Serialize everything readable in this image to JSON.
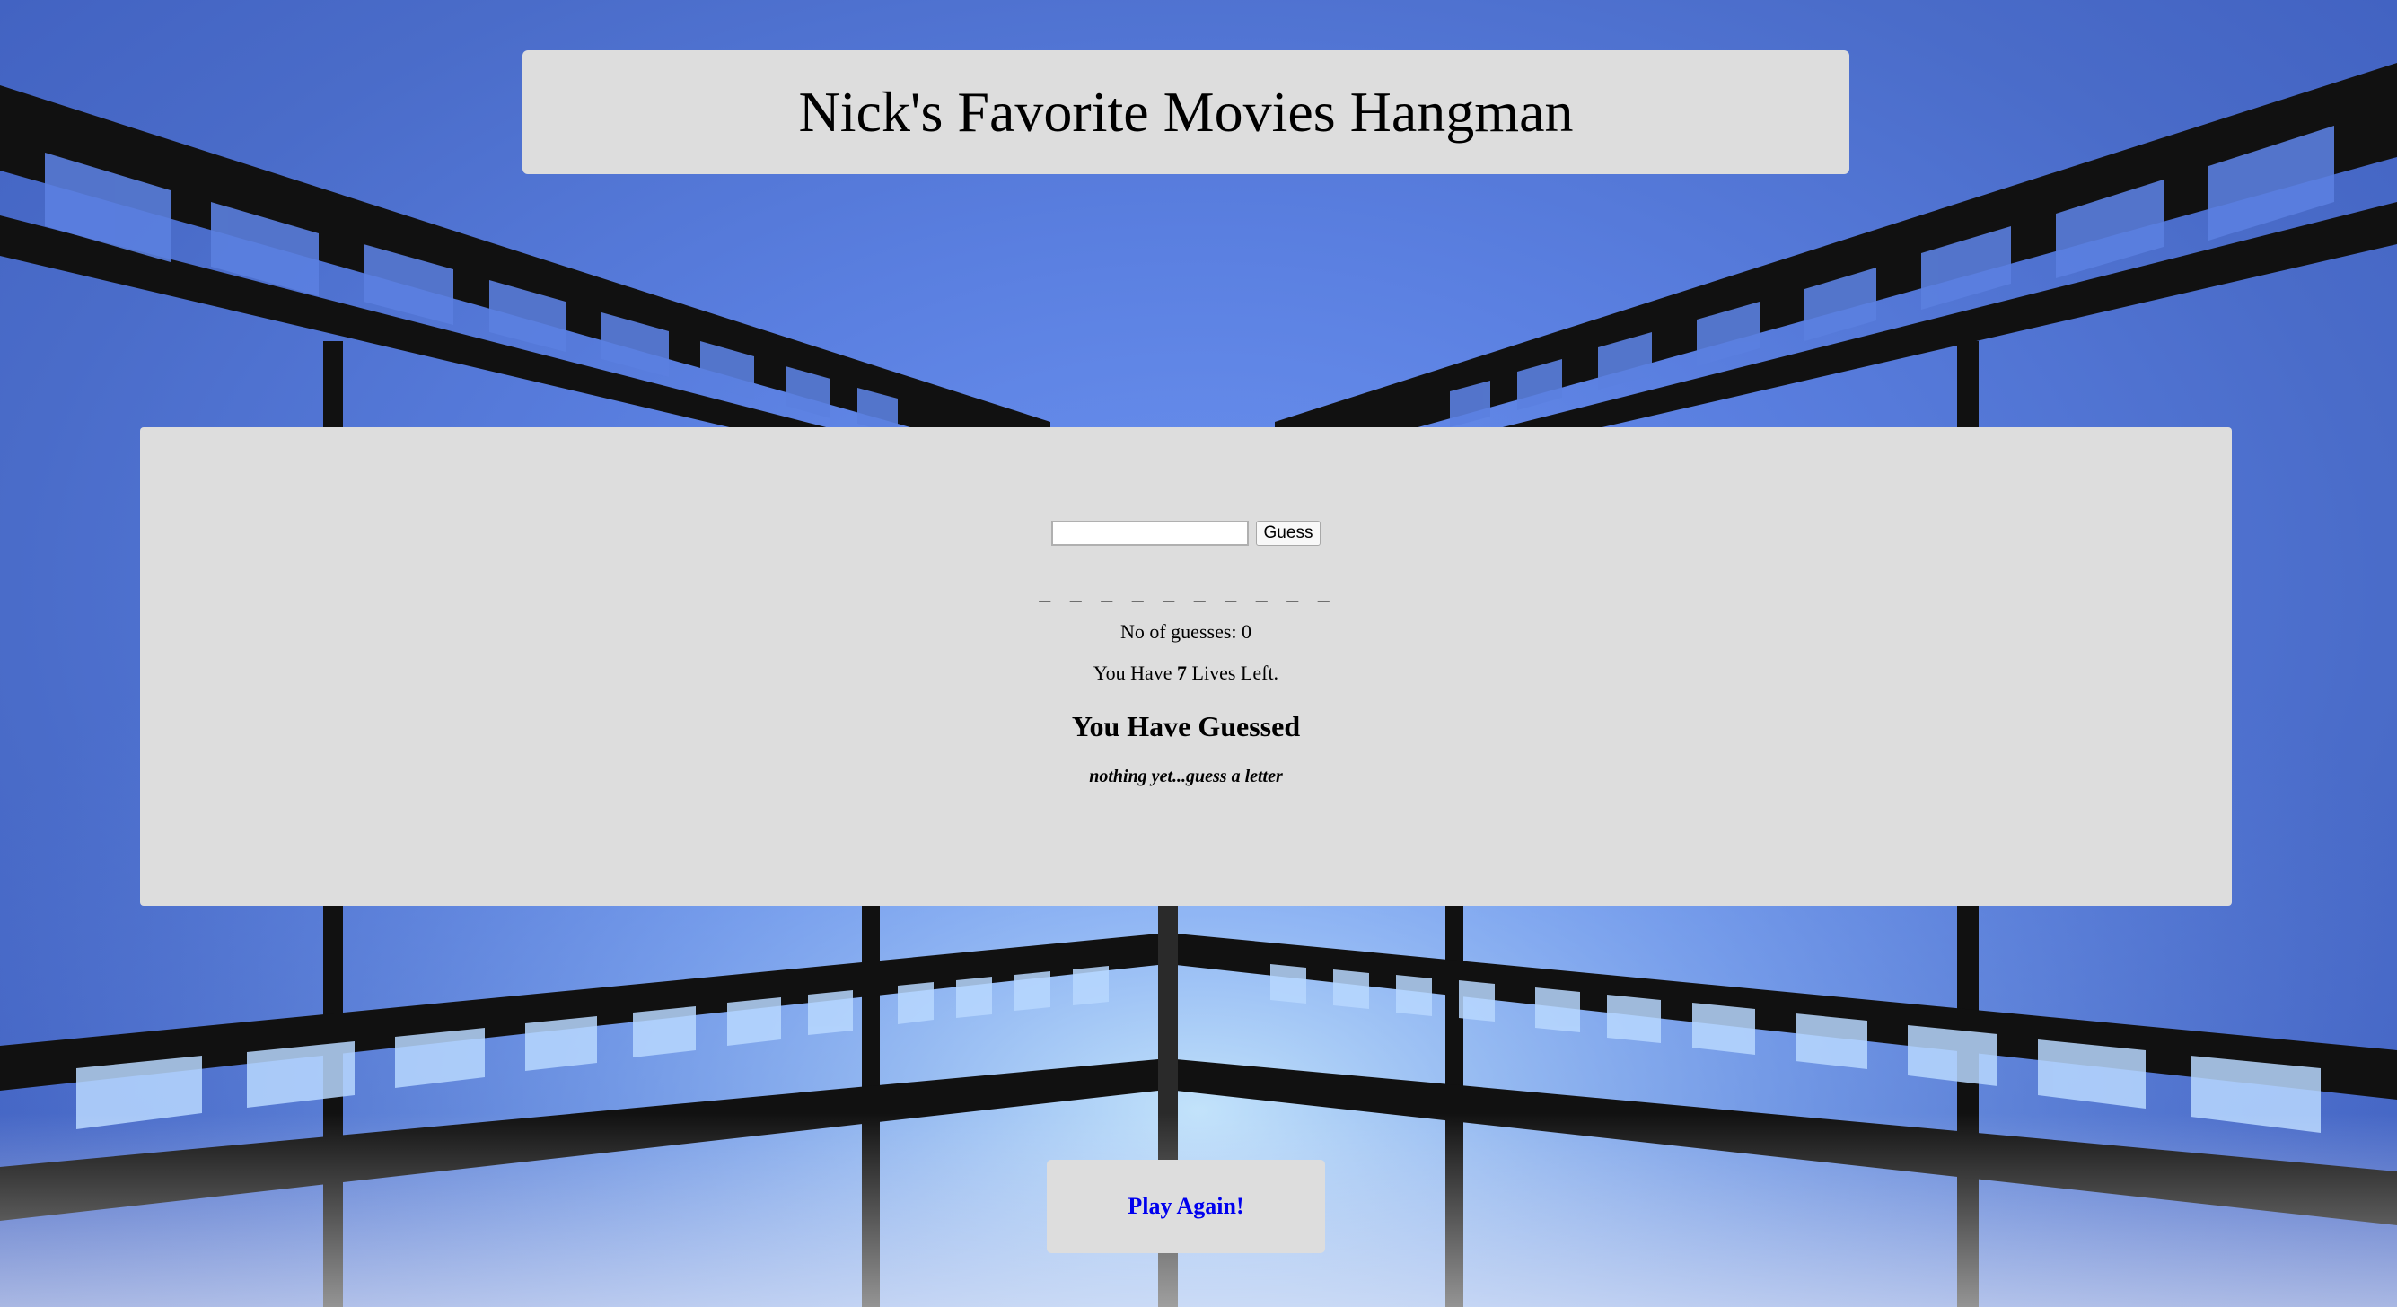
{
  "page": {
    "title": "Nick's Favorite Movies Hangman"
  },
  "game": {
    "input_value": "",
    "guess_button_label": "Guess",
    "blanks": "_ _ _ _ _ _ _ _ _ _",
    "guess_count_text": "No of guesses: 0",
    "lives_prefix": "You Have ",
    "lives_count": "7",
    "lives_suffix": " Lives Left.",
    "guessed_heading": "You Have Guessed",
    "guessed_letters": "nothing yet...guess a letter"
  },
  "footer": {
    "play_again_label": "Play Again!"
  },
  "colors": {
    "panel": "#dddddd",
    "link": "#0000ee",
    "sky": "#5a7fe0",
    "film": "#111111"
  }
}
